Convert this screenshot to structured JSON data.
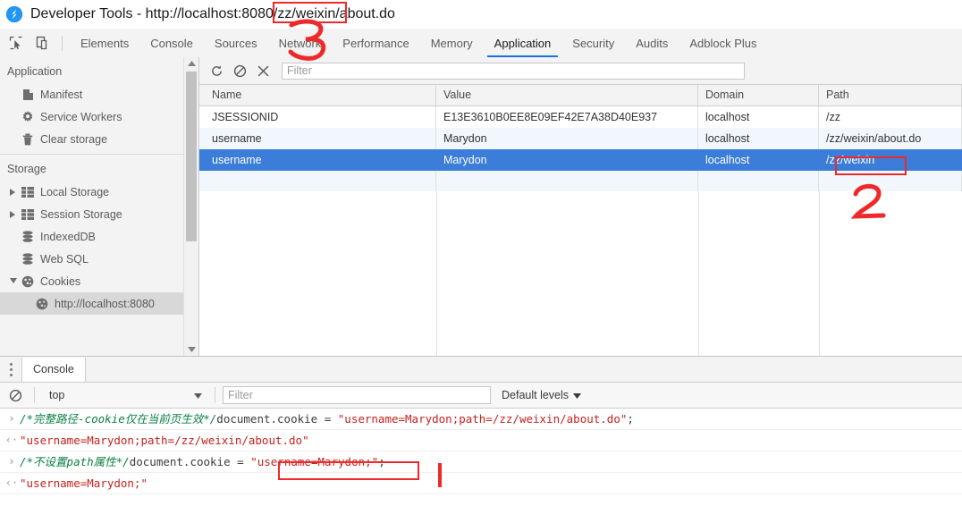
{
  "window": {
    "title": "Developer Tools - http://localhost:8080/zz/weixin/about.do",
    "logo_icon": "chrome-devtools-logo-icon"
  },
  "toolbar": {
    "inspect_icon": "inspect-element-icon",
    "device_icon": "device-toolbar-icon"
  },
  "tabs": [
    {
      "label": "Elements",
      "active": false
    },
    {
      "label": "Console",
      "active": false
    },
    {
      "label": "Sources",
      "active": false
    },
    {
      "label": "Network",
      "active": false
    },
    {
      "label": "Performance",
      "active": false
    },
    {
      "label": "Memory",
      "active": false
    },
    {
      "label": "Application",
      "active": true
    },
    {
      "label": "Security",
      "active": false
    },
    {
      "label": "Audits",
      "active": false
    },
    {
      "label": "Adblock Plus",
      "active": false
    }
  ],
  "sidebar": {
    "application_header": "Application",
    "application_items": [
      {
        "label": "Manifest",
        "icon": "document-icon"
      },
      {
        "label": "Service Workers",
        "icon": "gear-icon"
      },
      {
        "label": "Clear storage",
        "icon": "trash-icon"
      }
    ],
    "storage_header": "Storage",
    "storage_items": [
      {
        "label": "Local Storage",
        "icon": "table-icon",
        "twisty": "collapsed",
        "selected": false,
        "sub": false
      },
      {
        "label": "Session Storage",
        "icon": "table-icon",
        "twisty": "collapsed",
        "selected": false,
        "sub": false
      },
      {
        "label": "IndexedDB",
        "icon": "database-icon",
        "twisty": "none",
        "selected": false,
        "sub": false
      },
      {
        "label": "Web SQL",
        "icon": "database-icon",
        "twisty": "none",
        "selected": false,
        "sub": false
      },
      {
        "label": "Cookies",
        "icon": "cookie-icon",
        "twisty": "expanded",
        "selected": false,
        "sub": false
      },
      {
        "label": "http://localhost:8080",
        "icon": "cookie-icon",
        "twisty": "none",
        "selected": true,
        "sub": true
      }
    ],
    "scroll_up_icon": "scroll-up-arrow-icon",
    "scroll_down_icon": "scroll-down-arrow-icon"
  },
  "cookie_panel": {
    "refresh_icon": "refresh-icon",
    "clear_icon": "clear-all-cookies-icon",
    "delete_icon": "delete-cookie-icon",
    "filter_placeholder": "Filter",
    "filter_value": "",
    "columns": [
      "Name",
      "Value",
      "Domain",
      "Path"
    ],
    "rows": [
      {
        "name": "JSESSIONID",
        "value": "E13E3610B0EE8E09EF42E7A38D40E937",
        "domain": "localhost",
        "path": "/zz",
        "selected": false
      },
      {
        "name": "username",
        "value": "Marydon",
        "domain": "localhost",
        "path": "/zz/weixin/about.do",
        "selected": false
      },
      {
        "name": "username",
        "value": "Marydon",
        "domain": "localhost",
        "path": "/zz/weixin",
        "selected": true
      },
      {
        "name": "",
        "value": "",
        "domain": "",
        "path": "",
        "selected": false
      }
    ]
  },
  "drawer": {
    "menu_icon": "more-options-icon",
    "tab_label": "Console",
    "clear_console_icon": "clear-console-icon",
    "context_value": "top",
    "context_caret_icon": "chevron-down-icon",
    "filter_placeholder": "Filter",
    "filter_value": "",
    "levels_label": "Default levels",
    "levels_caret_icon": "chevron-down-icon",
    "lines": [
      {
        "kind": "input",
        "marker": "›",
        "comment": "/*完整路径-cookie仅在当前页生效*/",
        "code": "document.cookie = ",
        "string": "\"username=Marydon;path=/zz/weixin/about.do\"",
        "tail": ";"
      },
      {
        "kind": "output",
        "marker": "‹·",
        "text": "\"username=Marydon;path=/zz/weixin/about.do\""
      },
      {
        "kind": "input",
        "marker": "›",
        "comment": "/*不设置path属性*/",
        "code": "document.cookie = ",
        "string": "\"username=Marydon;\"",
        "tail": ";"
      },
      {
        "kind": "output",
        "marker": "‹·",
        "text": "\"username=Marydon;\""
      }
    ]
  },
  "annotations": {
    "accent_color": "#ef2929",
    "marks": [
      {
        "type": "box",
        "target": "title-url-path-segment",
        "label": ""
      },
      {
        "type": "digit",
        "target": "title-annotation",
        "label": "3"
      },
      {
        "type": "box",
        "target": "cookie-row-path-cell",
        "label": ""
      },
      {
        "type": "digit",
        "target": "cookie-row-annotation",
        "label": "2"
      },
      {
        "type": "box",
        "target": "console-string-literal",
        "label": ""
      },
      {
        "type": "stroke",
        "target": "console-cursor-stroke",
        "label": ""
      }
    ]
  }
}
